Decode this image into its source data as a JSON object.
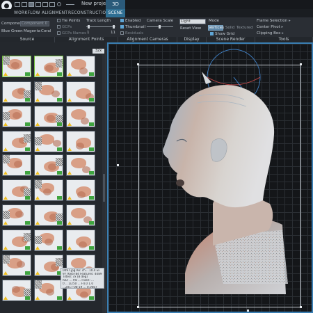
{
  "titlebar": {
    "project_name": "New project…",
    "view_tab": "3D"
  },
  "ribbon_tabs": [
    "WORKFLOW",
    "ALIGNMENT",
    "RECONSTRUCTION",
    "SCENE"
  ],
  "ribbon_active_tab": "SCENE",
  "ribbon": {
    "source": {
      "component_label": "Component",
      "component_value": "Component 0",
      "color_modes": [
        "Blue",
        "Green",
        "Magenta",
        "Coral"
      ],
      "group_label": "Source"
    },
    "alignment_points": {
      "tie_points": "Tie Points",
      "gcps": "GCPs",
      "gcp_names": "GCPs Names",
      "track_length_label": "Track Length",
      "track_min": "1",
      "track_max": "11",
      "group_label": "Alignment Points"
    },
    "alignment_cameras": {
      "enabled": "Enabled",
      "thumbnail": "Thumbnail",
      "residuals": "Residuals",
      "camera_scale_label": "Camera Scale",
      "group_label": "Alignment Cameras"
    },
    "display": {
      "dropdown_value": "Light",
      "reset_view": "Reset View",
      "group_label": "Display"
    },
    "scene_render": {
      "mode_label": "Mode",
      "modes": [
        "Vertices",
        "Solid",
        "Textured"
      ],
      "active_mode": "Vertices",
      "show_grid": "Show Grid",
      "group_label": "Scene Render"
    },
    "tools": {
      "frame_selection": "Frame Selection",
      "center_pivot": "Center Pivot",
      "clipping_box": "Clipping Box",
      "group_label": "Tools"
    }
  },
  "thumbnails": {
    "count_label": "32x"
  },
  "tooltip": {
    "lines": [
      "0097.jpg  Re: ch...  10.4 EF",
      "9776x6784  Features: 40897/4680",
      "Tilted: 7x (8 deg)",
      "ISO: ...  f/8 ...  Flash: ...",
      "f/...  1/250  ...  F4.0 1.0",
      "...2017-08-19 ... 0.0087"
    ]
  },
  "colors": {
    "accent": "#2f6f93",
    "viewport_border": "#3b7fb3",
    "selection_green": "#6fbf3a",
    "warning_yellow": "#f0c020"
  }
}
